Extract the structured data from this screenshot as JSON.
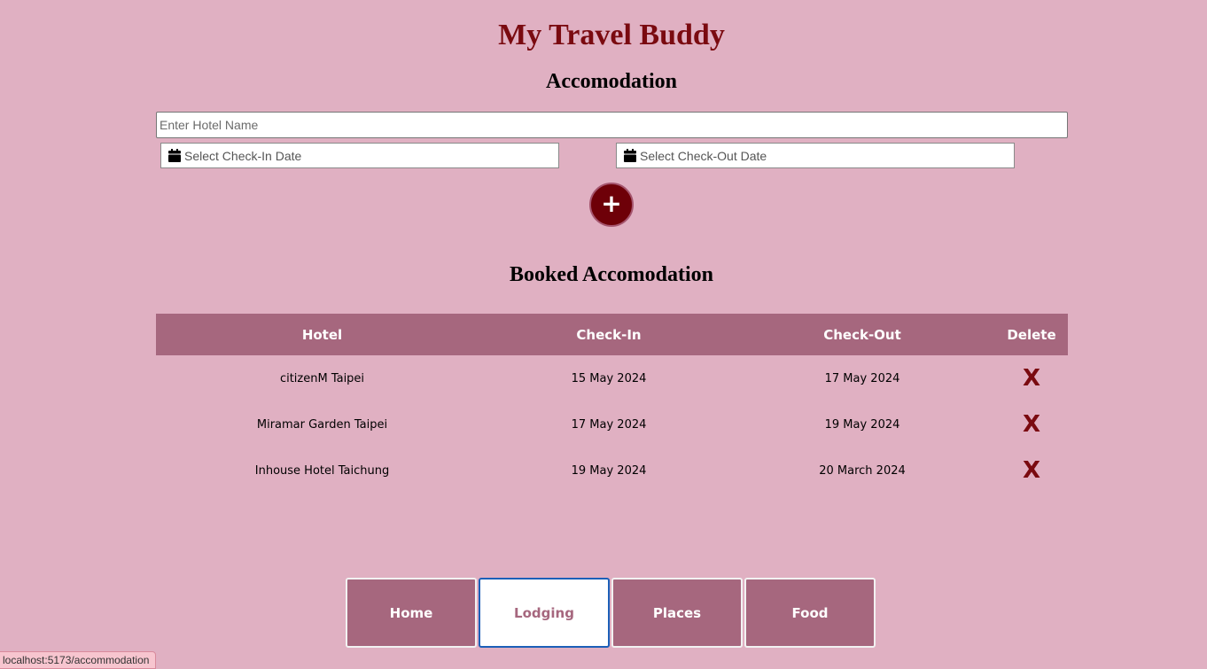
{
  "app": {
    "title": "My Travel Buddy"
  },
  "form": {
    "heading": "Accomodation",
    "hotel_placeholder": "Enter Hotel Name",
    "checkin_placeholder": "Select Check-In Date",
    "checkout_placeholder": "Select Check-Out Date",
    "add_icon": "plus-icon",
    "add_label": "+"
  },
  "bookings": {
    "heading": "Booked Accomodation",
    "columns": [
      "Hotel",
      "Check-In",
      "Check-Out",
      "Delete"
    ],
    "rows": [
      {
        "hotel": "citizenM Taipei",
        "checkin": "15 May 2024",
        "checkout": "17 May 2024",
        "delete": "X"
      },
      {
        "hotel": "Miramar Garden Taipei",
        "checkin": "17 May 2024",
        "checkout": "19 May 2024",
        "delete": "X"
      },
      {
        "hotel": "Inhouse Hotel Taichung",
        "checkin": "19 May 2024",
        "checkout": "20 March 2024",
        "delete": "X"
      }
    ]
  },
  "nav": {
    "tabs": [
      {
        "label": "Home",
        "active": false
      },
      {
        "label": "Lodging",
        "active": true
      },
      {
        "label": "Places",
        "active": false
      },
      {
        "label": "Food",
        "active": false
      }
    ]
  },
  "status_bar": {
    "url": "localhost:5173/accommodation"
  },
  "colors": {
    "background": "#e0b0c2",
    "accent": "#a6677e",
    "title": "#7a0a10",
    "add_button": "#6e0008",
    "active_tab_border": "#1c5fb8"
  }
}
